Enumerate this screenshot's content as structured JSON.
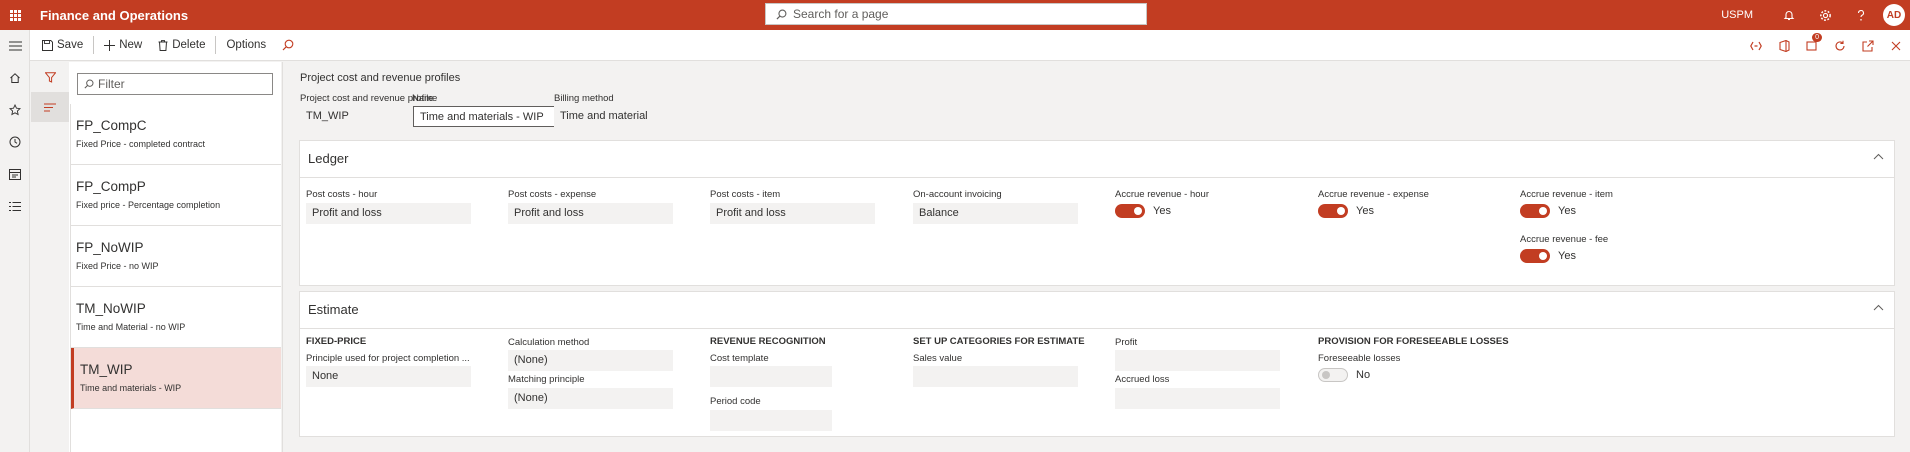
{
  "app": {
    "title": "Finance and Operations",
    "company": "USPM",
    "user_initials": "AD",
    "search_placeholder": "Search for a page",
    "notification_count": "0"
  },
  "toolbar": {
    "save": "Save",
    "new": "New",
    "delete": "Delete",
    "options": "Options"
  },
  "list": {
    "filter_placeholder": "Filter",
    "items": [
      {
        "id": "FP_CompC",
        "desc": "Fixed Price - completed contract"
      },
      {
        "id": "FP_CompP",
        "desc": "Fixed price - Percentage completion"
      },
      {
        "id": "FP_NoWIP",
        "desc": "Fixed Price - no WIP"
      },
      {
        "id": "TM_NoWIP",
        "desc": "Time and Material - no WIP"
      },
      {
        "id": "TM_WIP",
        "desc": "Time and materials - WIP"
      }
    ]
  },
  "header": {
    "title": "Project cost and revenue profiles",
    "profile_label": "Project cost and revenue profile",
    "profile_value": "TM_WIP",
    "name_label": "Name",
    "name_value": "Time and materials - WIP",
    "billing_label": "Billing method",
    "billing_value": "Time and material"
  },
  "ledger": {
    "title": "Ledger",
    "post_hour_label": "Post costs - hour",
    "post_hour_value": "Profit and loss",
    "post_expense_label": "Post costs - expense",
    "post_expense_value": "Profit and loss",
    "post_item_label": "Post costs - item",
    "post_item_value": "Profit and loss",
    "onaccount_label": "On-account invoicing",
    "onaccount_value": "Balance",
    "accrue_hour_label": "Accrue revenue - hour",
    "accrue_hour_value": "Yes",
    "accrue_expense_label": "Accrue revenue - expense",
    "accrue_expense_value": "Yes",
    "accrue_item_label": "Accrue revenue - item",
    "accrue_item_value": "Yes",
    "accrue_fee_label": "Accrue revenue - fee",
    "accrue_fee_value": "Yes"
  },
  "estimate": {
    "title": "Estimate",
    "fixed_price_head": "FIXED-PRICE",
    "principle_label": "Principle used for project completion ...",
    "principle_value": "None",
    "calc_method_label": "Calculation method",
    "calc_method_value": "(None)",
    "matching_label": "Matching principle",
    "matching_value": "(None)",
    "revrec_head": "REVENUE RECOGNITION",
    "cost_template_label": "Cost template",
    "cost_template_value": "",
    "period_code_label": "Period code",
    "period_code_value": "",
    "setup_head": "SET UP CATEGORIES FOR ESTIMATE",
    "sales_value_label": "Sales value",
    "sales_value_value": "",
    "profit_label": "Profit",
    "profit_value": "",
    "accrued_loss_label": "Accrued loss",
    "accrued_loss_value": "",
    "provision_head": "PROVISION FOR FORESEEABLE LOSSES",
    "foreseeable_label": "Foreseeable losses",
    "foreseeable_value": "No"
  },
  "colors": {
    "brand": "#c23d22",
    "selected_row": "#f4dcd8"
  }
}
